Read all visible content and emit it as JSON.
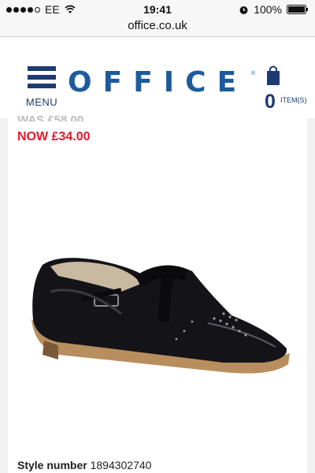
{
  "status_bar": {
    "carrier": "EE",
    "time": "19:41",
    "battery": "100%",
    "url": "office.co.uk"
  },
  "header": {
    "menu_label": "MENU",
    "logo": "OFFICE",
    "logo_reg": "®",
    "basket_count": "0",
    "basket_label": "ITEM(S)"
  },
  "product": {
    "was_price": "WAS £58.00",
    "now_price": "NOW £34.00",
    "style_label": "Style number",
    "style_number": "1894302740"
  },
  "colors": {
    "brand_blue": "#1d5b9c",
    "navy": "#1d3b72",
    "sale_red": "#e0192b"
  }
}
